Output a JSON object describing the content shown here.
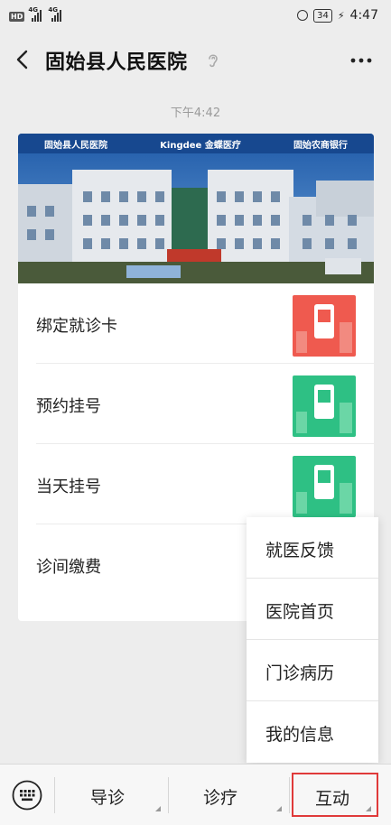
{
  "status_bar": {
    "hd": "HD",
    "signal_1_tag": "4G",
    "signal_2_tag": "4G",
    "battery": "34",
    "time": "4:47"
  },
  "header": {
    "title": "固始县人民医院",
    "back_icon": "chevron-left-icon",
    "ear_icon": "ear-icon",
    "more_icon": "more-dots-icon"
  },
  "chat": {
    "timestamp": "下午4:42"
  },
  "card": {
    "banner_logos": [
      "固始县人民医院",
      "Kingdee 金蝶医疗",
      "固始农商银行"
    ],
    "items": [
      {
        "label": "绑定就诊卡",
        "thumb_color": "#ef5a4f"
      },
      {
        "label": "预约挂号",
        "thumb_color": "#2ec084"
      },
      {
        "label": "当天挂号",
        "thumb_color": "#2ec084"
      },
      {
        "label": "诊间缴费",
        "thumb_color": "#f0a640"
      }
    ]
  },
  "popup_menu": {
    "items": [
      "就医反馈",
      "医院首页",
      "门诊病历",
      "我的信息"
    ]
  },
  "bottom_bar": {
    "keyboard_icon": "keyboard-icon",
    "tabs": [
      "导诊",
      "诊疗",
      "互动"
    ],
    "active_tab": "互动",
    "highlight_color": "#e03a3a"
  }
}
